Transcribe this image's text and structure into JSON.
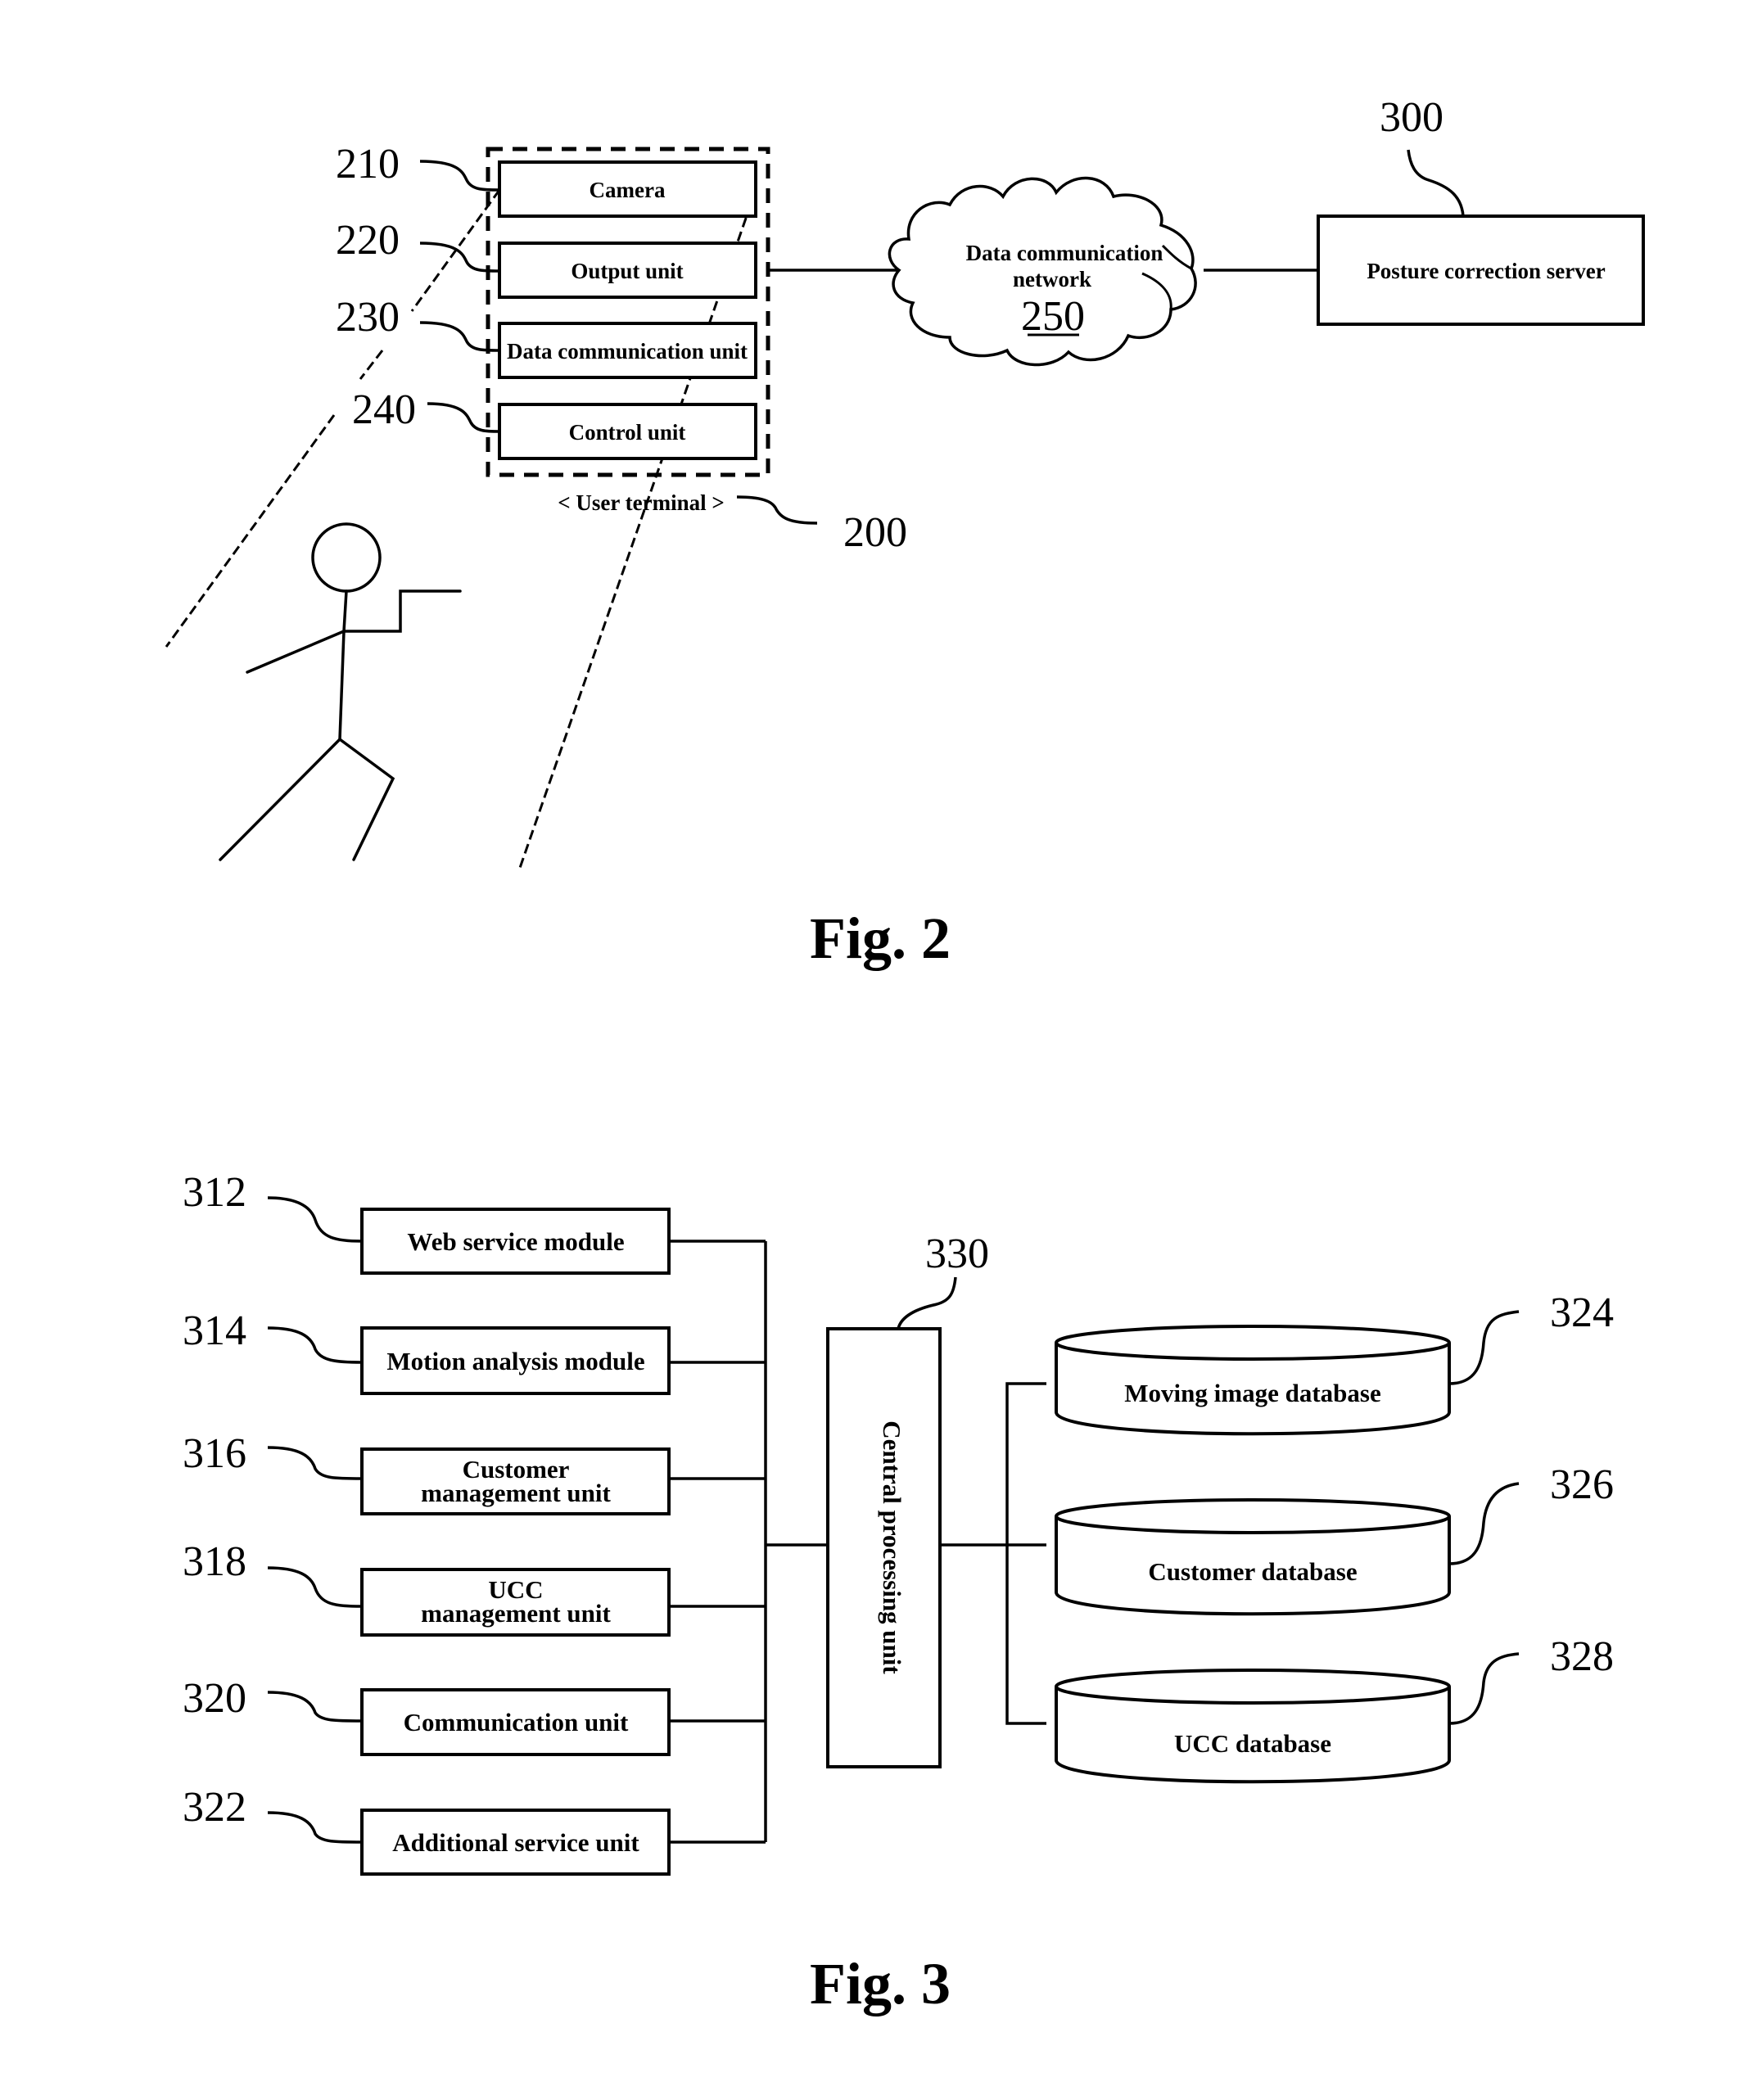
{
  "fig2": {
    "caption": "Fig. 2",
    "user_terminal": {
      "ref": "200",
      "label": "< User terminal >",
      "components": [
        {
          "ref": "210",
          "label": "Camera"
        },
        {
          "ref": "220",
          "label": "Output unit"
        },
        {
          "ref": "230",
          "label": "Data communication unit"
        },
        {
          "ref": "240",
          "label": "Control unit"
        }
      ]
    },
    "network": {
      "ref": "250",
      "label_line1": "Data communication",
      "label_line2": "network"
    },
    "server": {
      "ref": "300",
      "label": "Posture correction server"
    },
    "user_figure_icon": "stick-figure-icon"
  },
  "fig3": {
    "caption": "Fig. 3",
    "modules": [
      {
        "ref": "312",
        "line1": "Web service module",
        "line2": ""
      },
      {
        "ref": "314",
        "line1": "Motion analysis module",
        "line2": ""
      },
      {
        "ref": "316",
        "line1": "Customer",
        "line2": "management unit"
      },
      {
        "ref": "318",
        "line1": "UCC",
        "line2": "management unit"
      },
      {
        "ref": "320",
        "line1": "Communication unit",
        "line2": ""
      },
      {
        "ref": "322",
        "line1": "Additional service unit",
        "line2": ""
      }
    ],
    "cpu": {
      "ref": "330",
      "label": "Central processing unit"
    },
    "databases": [
      {
        "ref": "324",
        "label": "Moving image database"
      },
      {
        "ref": "326",
        "label": "Customer database"
      },
      {
        "ref": "328",
        "label": "UCC database"
      }
    ]
  }
}
